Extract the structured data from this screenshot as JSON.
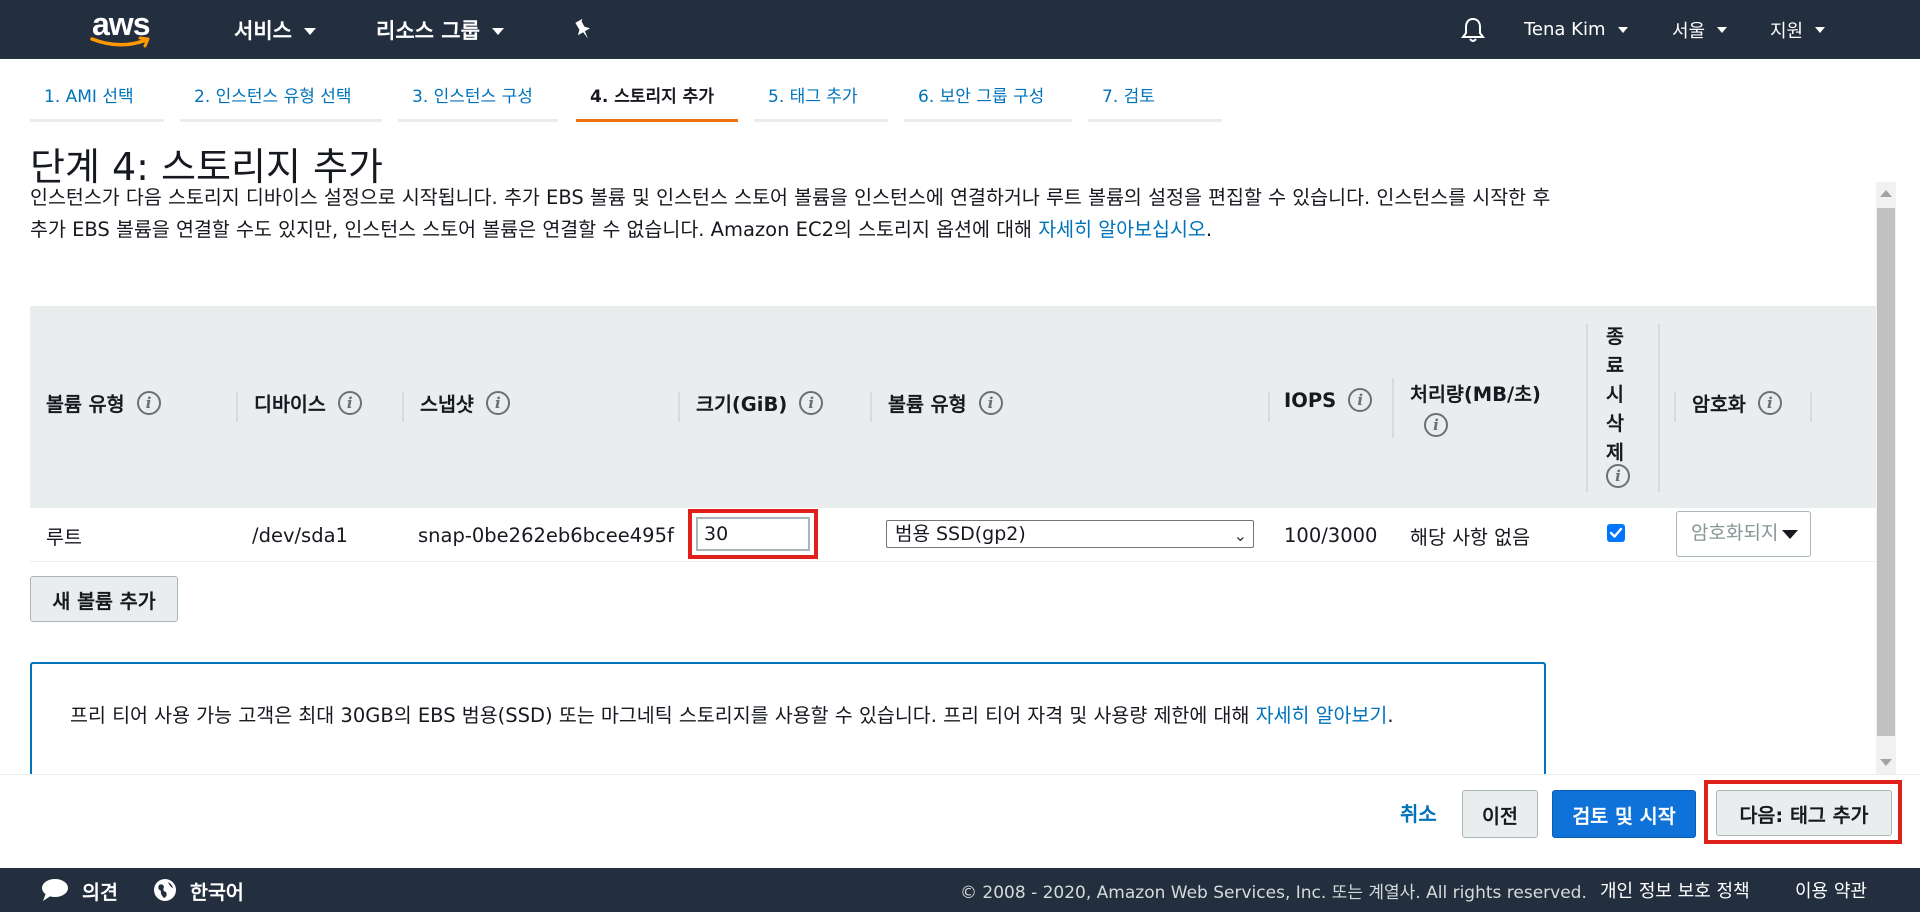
{
  "nav": {
    "logo_text": "aws",
    "services": "서비스",
    "resource_groups": "리소스 그룹",
    "user": "Tena Kim",
    "region": "서울",
    "support": "지원"
  },
  "wizard_steps": [
    {
      "label": "1. AMI 선택"
    },
    {
      "label": "2. 인스턴스 유형 선택"
    },
    {
      "label": "3. 인스턴스 구성"
    },
    {
      "label": "4. 스토리지 추가"
    },
    {
      "label": "5. 태그 추가"
    },
    {
      "label": "6. 보안 그룹 구성"
    },
    {
      "label": "7. 검토"
    }
  ],
  "page": {
    "title": "단계 4: 스토리지 추가",
    "description": "인스턴스가 다음 스토리지 디바이스 설정으로 시작됩니다. 추가 EBS 볼륨 및 인스턴스 스토어 볼륨을 인스턴스에 연결하거나 루트 볼륨의 설정을 편집할 수 있습니다. 인스턴스를 시작한 후 추가 EBS 볼륨을 연결할 수도 있지만, 인스턴스 스토어 볼륨은 연결할 수 없습니다. Amazon EC2의 스토리지 옵션에 대해 ",
    "learn_more": "자세히 알아보십시오",
    "period": "."
  },
  "table": {
    "headers": {
      "volume_type": "볼륨 유형",
      "device": "디바이스",
      "snapshot": "스냅샷",
      "size": "크기(GiB)",
      "volume_kind": "볼륨 유형",
      "iops": "IOPS",
      "throughput": "처리량(MB/초)",
      "delete_on_termination": [
        "종",
        "료",
        "시",
        "삭",
        "제"
      ],
      "encryption": "암호화"
    },
    "row": {
      "volume_type": "루트",
      "device": "/dev/sda1",
      "snapshot": "snap-0be262eb6bcee495f",
      "size": "30",
      "volume_kind": "범용 SSD(gp2)",
      "iops": "100/3000",
      "throughput": "해당 사항 없음",
      "delete_on_termination": true,
      "encryption": "암호화되지"
    }
  },
  "add_volume_button": "새 볼륨 추가",
  "alert": {
    "text": "프리 티어 사용 가능 고객은 최대 30GB의 EBS 범용(SSD) 또는 마그네틱 스토리지를 사용할 수 있습니다. 프리 티어 자격 및 사용량 제한에 대해 ",
    "learn_more": "자세히 알아보기",
    "period": "."
  },
  "actions": {
    "cancel": "취소",
    "previous": "이전",
    "review_launch": "검토 및 시작",
    "next": "다음: 태그 추가"
  },
  "footer": {
    "feedback": "의견",
    "language": "한국어",
    "copyright": "© 2008 - 2020, Amazon Web Services, Inc. 또는 계열사. All rights reserved.",
    "privacy": "개인 정보 보호 정책",
    "terms": "이용 약관"
  },
  "colors": {
    "nav_bg": "#232f3e",
    "link": "#0073bb",
    "active_tab": "#ec7211",
    "primary_button": "#0f72d8",
    "highlight": "#e0201b"
  }
}
